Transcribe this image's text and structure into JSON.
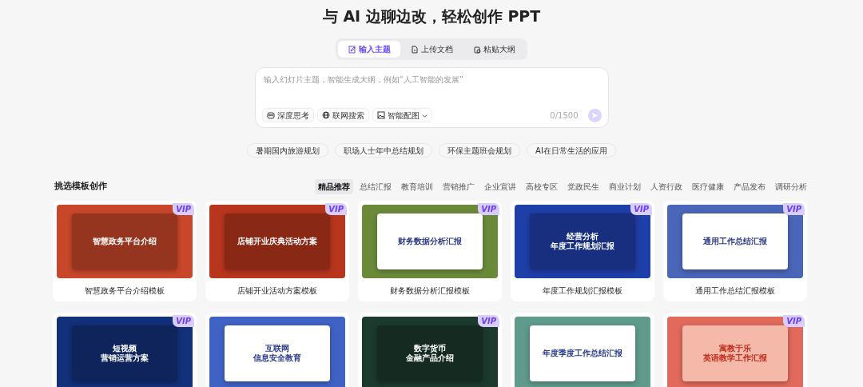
{
  "headline": "与 AI 边聊边改，轻松创作 PPT",
  "tabs": [
    {
      "label": "输入主题",
      "selected": true
    },
    {
      "label": "上传文档",
      "selected": false
    },
    {
      "label": "粘贴大纲",
      "selected": false
    }
  ],
  "prompt": {
    "placeholder": "输入幻灯片主题，智能生成大纲，例如“人工智能的发展”",
    "counter": "0/1500",
    "send_disabled": true,
    "tools": [
      {
        "label": "深度思考",
        "dropdown": false
      },
      {
        "label": "联网搜索",
        "dropdown": false
      },
      {
        "label": "智能配图",
        "dropdown": true
      }
    ]
  },
  "suggestions": [
    "暑期国内旅游规划",
    "职场人士年中总结规划",
    "环保主题班会规划",
    "AI在日常生活的应用"
  ],
  "section_title": "挑选模板创作",
  "categories": [
    {
      "label": "精品推荐",
      "selected": true
    },
    {
      "label": "总结汇报",
      "selected": false
    },
    {
      "label": "教育培训",
      "selected": false
    },
    {
      "label": "营销推广",
      "selected": false
    },
    {
      "label": "企业宣讲",
      "selected": false
    },
    {
      "label": "高校专区",
      "selected": false
    },
    {
      "label": "党政民生",
      "selected": false
    },
    {
      "label": "商业计划",
      "selected": false
    },
    {
      "label": "人资行政",
      "selected": false
    },
    {
      "label": "医疗健康",
      "selected": false
    },
    {
      "label": "产品发布",
      "selected": false
    },
    {
      "label": "调研分析",
      "selected": false
    }
  ],
  "templates": [
    {
      "slide_title": [
        "智慧政务平台介绍"
      ],
      "caption": "智慧政务平台介绍模板",
      "tag": "VIP",
      "color": "#c8472a",
      "kind": "dark"
    },
    {
      "slide_title": [
        "店铺开业庆典活动方案"
      ],
      "caption": "店铺开业活动方案模板",
      "tag": "VIP",
      "color": "#b8361e",
      "kind": "dark"
    },
    {
      "slide_title": [
        "财务数据分析汇报"
      ],
      "caption": "财务数据分析汇报模板",
      "tag": "VIP",
      "color": "#6a8a3a",
      "kind": "light"
    },
    {
      "slide_title": [
        "经营分析",
        "年度工作规划汇报"
      ],
      "caption": "年度工作规划汇报模板",
      "tag": "VIP",
      "color": "#1f3fa8",
      "kind": "dark"
    },
    {
      "slide_title": [
        "通用工作总结汇报"
      ],
      "caption": "通用工作总结汇报模板",
      "tag": "VIP",
      "color": "#4a66b8",
      "kind": "light"
    },
    {
      "slide_title": [
        "短视频",
        "营销运营方案"
      ],
      "tag": "VIP",
      "color": "#13307a",
      "kind": "dark"
    },
    {
      "slide_title": [
        "互联网",
        "信息安全教育"
      ],
      "color": "#3f62c4",
      "kind": "light"
    },
    {
      "slide_title": [
        "数字货币",
        "金融产品介绍"
      ],
      "tag": "VIP",
      "color": "#1d3a2e",
      "kind": "dark"
    },
    {
      "slide_title": [
        "年度季度工作总结汇报"
      ],
      "color": "#5f9a8a",
      "kind": "light"
    },
    {
      "slide_title": [
        "寓教于乐",
        "英语教学工作汇报"
      ],
      "tag": "VIP",
      "color": "#e06a5c",
      "kind": "warm"
    }
  ]
}
